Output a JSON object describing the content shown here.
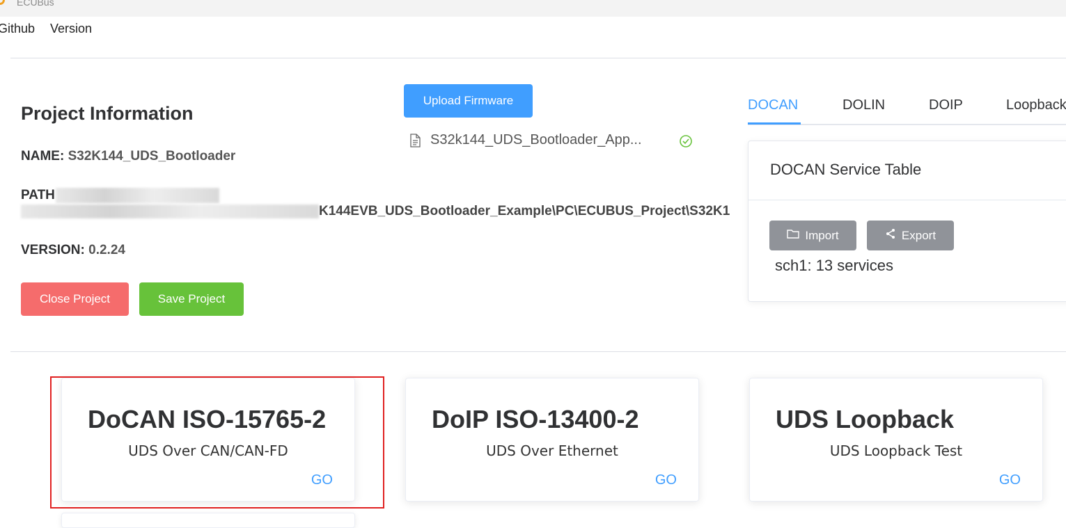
{
  "window": {
    "title": "ECUBus",
    "accent": "#f0a020"
  },
  "menu": {
    "items": [
      "Github",
      "Version"
    ]
  },
  "project": {
    "heading": "Project Information",
    "name_label": "NAME:",
    "name_value": "S32K144_UDS_Bootloader",
    "path_label": "PATH",
    "path_value": "K144EVB_UDS_Bootloader_Example\\PC\\ECUBUS_Project\\S32K1",
    "version_label": "VERSION:",
    "version_value": "0.2.24",
    "close_label": "Close Project",
    "save_label": "Save Project"
  },
  "firmware": {
    "upload_label": "Upload Firmware",
    "file_name": "S32k144_UDS_Bootloader_App...",
    "file_icon": "document-icon",
    "status_icon": "check-circle-icon"
  },
  "tabs": {
    "items": [
      "DOCAN",
      "DOLIN",
      "DOIP",
      "Loopback"
    ],
    "active": "DOCAN"
  },
  "service_table": {
    "title": "DOCAN Service Table",
    "import_label": "Import",
    "export_label": "Export",
    "summary": "sch1: 13 services"
  },
  "protocols": [
    {
      "title": "DoCAN ISO-15765-2",
      "subtitle": "UDS Over CAN/CAN-FD",
      "go": "GO"
    },
    {
      "title": "DoIP ISO-13400-2",
      "subtitle": "UDS Over Ethernet",
      "go": "GO"
    },
    {
      "title": "UDS Loopback",
      "subtitle": "UDS Loopback Test",
      "go": "GO"
    }
  ],
  "colors": {
    "primary": "#409eff",
    "danger": "#f56c6c",
    "success": "#67c23a",
    "info": "#909399",
    "highlight": "#e02020"
  }
}
